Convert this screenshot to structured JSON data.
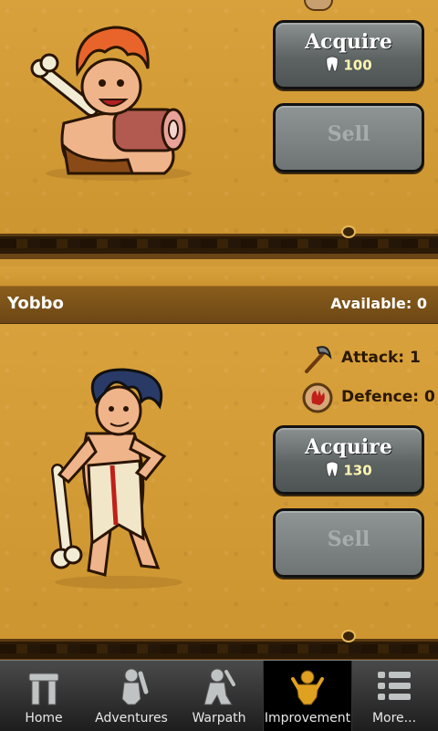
{
  "cards": [
    {
      "character": "caveman-with-bone-and-meat",
      "acquire_label": "Acquire",
      "price": "100",
      "sell_label": "Sell"
    },
    {
      "name": "Yobbo",
      "available": "Available: 0",
      "attack": "Attack: 1",
      "defence": "Defence: 0",
      "acquire_label": "Acquire",
      "price": "130",
      "sell_label": "Sell"
    }
  ],
  "tabs": [
    {
      "label": "Home",
      "icon": "stone-arch-icon"
    },
    {
      "label": "Adventures",
      "icon": "caveman-club-icon"
    },
    {
      "label": "Warpath",
      "icon": "warrior-icon"
    },
    {
      "label": "Improvement",
      "icon": "improvement-icon",
      "active": true
    },
    {
      "label": "More...",
      "icon": "list-icon"
    }
  ],
  "colors": {
    "sand": "#d19a37",
    "header": "#7a5219",
    "stone_button": "#5d6463",
    "price_text": "#fff6b0",
    "active_tab": "#000000"
  }
}
